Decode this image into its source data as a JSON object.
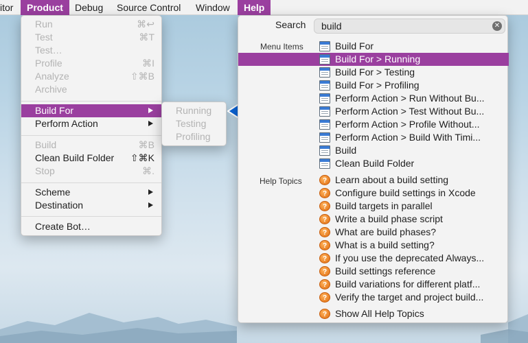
{
  "menubar": {
    "items": [
      {
        "label": "itor",
        "active": false
      },
      {
        "label": "Product",
        "active": true
      },
      {
        "label": "Debug",
        "active": false
      },
      {
        "label": "Source Control",
        "active": false
      },
      {
        "label": "Window",
        "active": false
      },
      {
        "label": "Help",
        "active": true
      }
    ]
  },
  "product_menu": {
    "items": [
      {
        "label": "Run",
        "shortcut": "⌘↩",
        "disabled": true
      },
      {
        "label": "Test",
        "shortcut": "⌘T",
        "disabled": true
      },
      {
        "label": "Test…",
        "shortcut": "",
        "disabled": true
      },
      {
        "label": "Profile",
        "shortcut": "⌘I",
        "disabled": true
      },
      {
        "label": "Analyze",
        "shortcut": "⇧⌘B",
        "disabled": true
      },
      {
        "label": "Archive",
        "shortcut": "",
        "disabled": true
      },
      {
        "label": "Build For",
        "submenu": true,
        "highlighted": true
      },
      {
        "label": "Perform Action",
        "submenu": true
      },
      {
        "label": "Build",
        "shortcut": "⌘B",
        "disabled": true
      },
      {
        "label": "Clean Build Folder",
        "shortcut": "⇧⌘K",
        "disabled": false
      },
      {
        "label": "Stop",
        "shortcut": "⌘.",
        "disabled": true
      },
      {
        "label": "Scheme",
        "submenu": true
      },
      {
        "label": "Destination",
        "submenu": true
      },
      {
        "label": "Create Bot…",
        "shortcut": ""
      }
    ]
  },
  "build_for_submenu": {
    "items": [
      {
        "label": "Running",
        "disabled": true
      },
      {
        "label": "Testing",
        "disabled": true
      },
      {
        "label": "Profiling",
        "disabled": true
      }
    ]
  },
  "help_panel": {
    "search_label": "Search",
    "search_value": "build",
    "clear_icon": "x-circle-icon",
    "menu_items_label": "Menu Items",
    "menu_items": [
      "Build For",
      "Build For > Running",
      "Build For > Testing",
      "Build For > Profiling",
      "Perform Action > Run Without Bu...",
      "Perform Action > Test Without Bu...",
      "Perform Action > Profile Without...",
      "Perform Action > Build With Timi...",
      "Build",
      "Clean Build Folder"
    ],
    "highlighted_index": 1,
    "help_topics_label": "Help Topics",
    "help_topics": [
      "Learn about a build setting",
      "Configure build settings in Xcode",
      "Build targets in parallel",
      "Write a build phase script",
      "What are build phases?",
      "What is a build setting?",
      "If you use the deprecated Always...",
      "Build settings reference",
      "Build variations for different platf...",
      "Verify the target and project build..."
    ],
    "show_all": "Show All Help Topics"
  },
  "colors": {
    "accent": "#9a3f9f",
    "pointer": "#0a64d6"
  }
}
